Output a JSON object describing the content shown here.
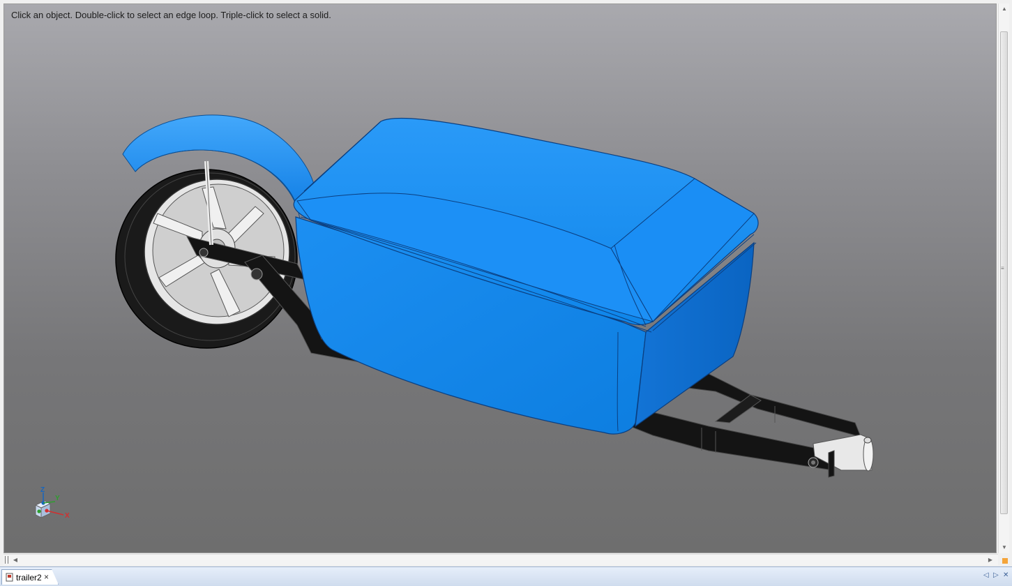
{
  "viewport": {
    "hint": "Click an object. Double-click to select an edge loop. Triple-click to select a solid."
  },
  "triad": {
    "axis_z": "Z",
    "axis_y": "Y",
    "axis_x": "X"
  },
  "tabs": [
    {
      "label": "trailer2",
      "close": "×"
    }
  ],
  "tab_nav": {
    "prev": "◁",
    "next": "▷",
    "close": "✕"
  },
  "colors": {
    "shell": "#1a8ef5",
    "frame": "#141414",
    "tire": "#1a1a1a",
    "rim": "#e6e6e6",
    "background_top": "#a9a9ae",
    "background_bottom": "#6e6e6e"
  },
  "icons": [
    "split-handle-icon",
    "scroll-left-icon",
    "scroll-right-icon",
    "scroll-up-icon",
    "scroll-down-icon",
    "document-icon",
    "close-icon"
  ]
}
